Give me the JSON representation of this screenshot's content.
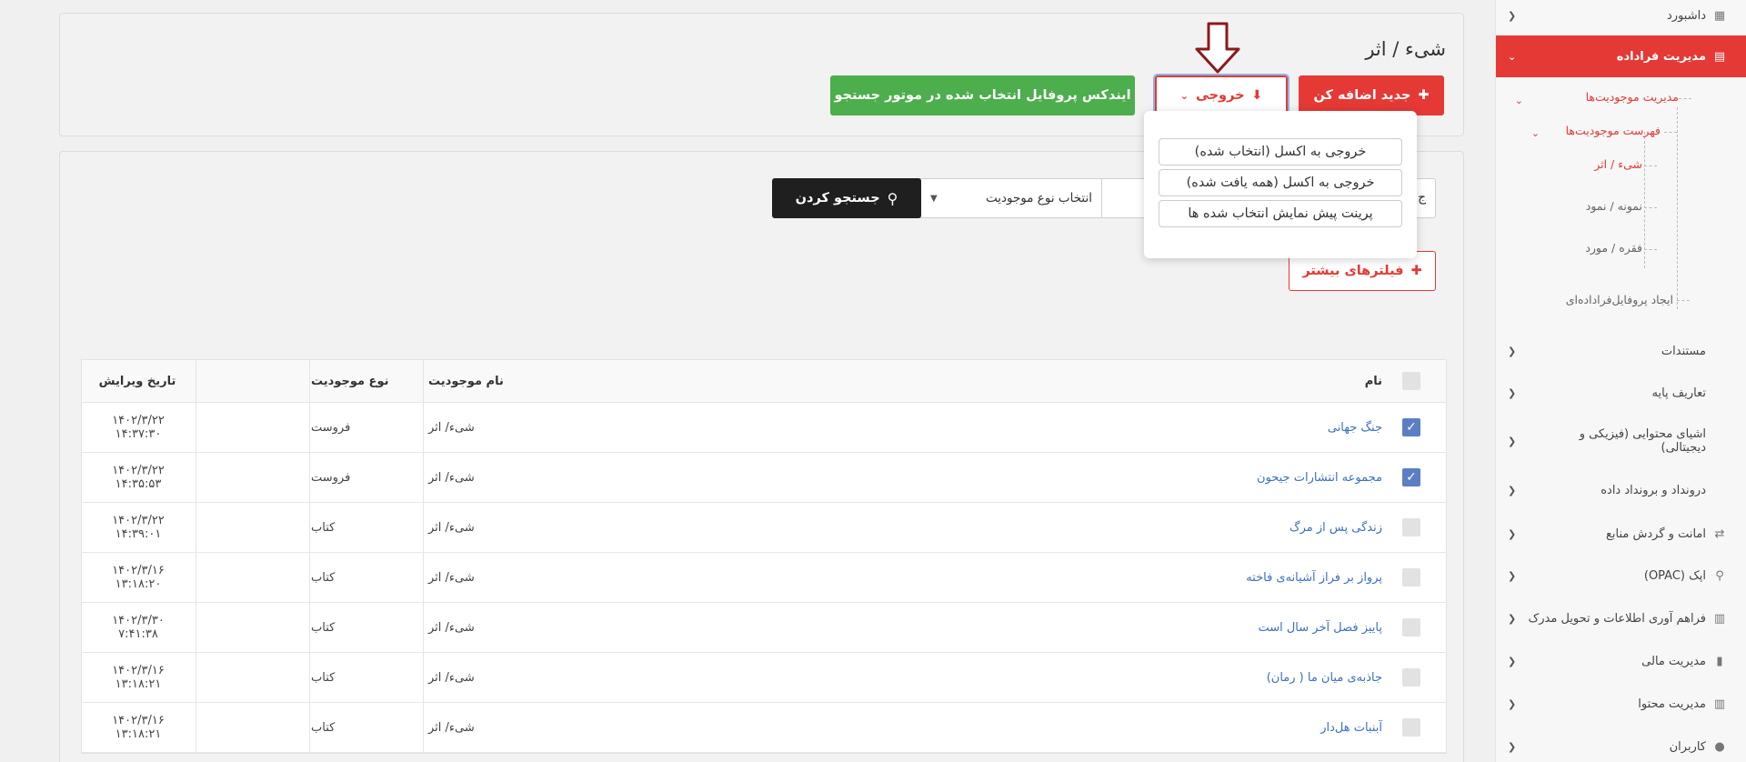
{
  "sidebar": {
    "dashboard": "داشبورد",
    "metadata": "مدیریت فراداده",
    "entities": "مدیریت موجودیت‌ها",
    "entity_list": "فهرست موجودیت‌ها",
    "object": "شیء / اثر",
    "instance": "نمونه / نمود",
    "item": "فقره / مورد",
    "create_profile": "ایجاد پروفایل‌فراداده‌ای",
    "documents": "مستندات",
    "base_defs": "تعاریف پایه",
    "content_objects": "اشیای محتوایی (فیزیکی و دیجیتالی)",
    "io": "درونداد و برونداد داده",
    "circulation": "امانت و گردش منابع",
    "opac": "اپک (OPAC)",
    "acquisition": "فراهم آوری اطلاعات و تحویل مدرک",
    "finance": "مدیریت مالی",
    "content": "مدیریت محتوا",
    "users": "کاربران"
  },
  "header": {
    "title": "شیء / اثر",
    "add_new": "جدید اضافه کن",
    "export": "خروجی",
    "index_profile": "ایندکس پروفایل انتخاب شده در موتور جستجو"
  },
  "export_menu": {
    "excel_selected": "خروجی به اکسل (انتخاب شده)",
    "excel_all": "خروجی به اکسل (همه یافت شده)",
    "print_preview": "پرینت پیش نمایش انتخاب شده ها"
  },
  "search": {
    "entity_type_placeholder": "انتخاب نوع موجودیت",
    "search_button": "جستجو کردن",
    "more_filters": "فیلترهای بیشتر",
    "left_edge_char": "ج"
  },
  "table": {
    "headers": {
      "name": "نام",
      "entity_name": "نام موجودیت",
      "entity_type": "نوع موجودیت",
      "edit_date": "تاریخ ویرایش"
    },
    "rows": [
      {
        "checked": true,
        "name": "جنگ جهانی",
        "entity": "شیء/ اثر",
        "type": "فروست",
        "date": "۱۴۰۲/۳/۲۲",
        "time": "۱۴:۳۷:۳۰"
      },
      {
        "checked": true,
        "name": "مجموعه انتشارات جیحون",
        "entity": "شیء/ اثر",
        "type": "فروست",
        "date": "۱۴۰۲/۳/۲۲",
        "time": "۱۴:۳۵:۵۳"
      },
      {
        "checked": false,
        "name": "زندگی پس از مرگ",
        "entity": "شیء/ اثر",
        "type": "کتاب",
        "date": "۱۴۰۲/۳/۲۲",
        "time": "۱۴:۳۹:۰۱"
      },
      {
        "checked": false,
        "name": "پرواز بر فراز آشیانه‌ی فاخته",
        "entity": "شیء/ اثر",
        "type": "کتاب",
        "date": "۱۴۰۲/۳/۱۶",
        "time": "۱۳:۱۸:۲۰"
      },
      {
        "checked": false,
        "name": "پاییز فصل آخر سال است",
        "entity": "شیء/ اثر",
        "type": "کتاب",
        "date": "۱۴۰۲/۳/۳۰",
        "time": "۷:۴۱:۳۸"
      },
      {
        "checked": false,
        "name": "جاذبه‌ی میان ما ( رمان)",
        "entity": "شیء/ اثر",
        "type": "کتاب",
        "date": "۱۴۰۲/۳/۱۶",
        "time": "۱۳:۱۸:۲۱"
      },
      {
        "checked": false,
        "name": "آبنبات هل‌دار",
        "entity": "شیء/ اثر",
        "type": "کتاب",
        "date": "۱۴۰۲/۳/۱۶",
        "time": "۱۳:۱۸:۲۱"
      }
    ]
  }
}
